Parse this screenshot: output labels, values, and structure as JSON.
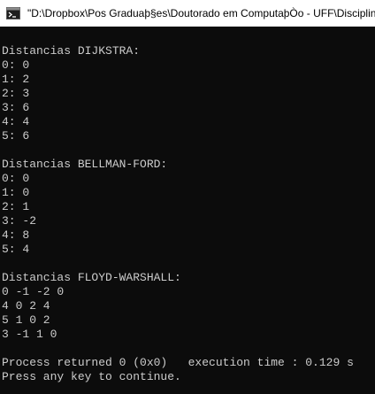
{
  "window": {
    "title": "\"D:\\Dropbox\\Pos Graduaþ§es\\Doutorado em ComputaþÒo - UFF\\Disciplina",
    "icon": "console-app-icon"
  },
  "console": {
    "lines": [
      "",
      "Distancias DIJKSTRA:",
      "0: 0",
      "1: 2",
      "2: 3",
      "3: 6",
      "4: 4",
      "5: 6",
      "",
      "Distancias BELLMAN-FORD:",
      "0: 0",
      "1: 0",
      "2: 1",
      "3: -2",
      "4: 8",
      "5: 4",
      "",
      "Distancias FLOYD-WARSHALL:",
      "0 -1 -2 0",
      "4 0 2 4",
      "5 1 0 2",
      "3 -1 1 0",
      "",
      "Process returned 0 (0x0)   execution time : 0.129 s",
      "Press any key to continue."
    ]
  },
  "colors": {
    "background": "#0c0c0c",
    "text": "#cccccc",
    "titlebar": "#ffffff"
  }
}
